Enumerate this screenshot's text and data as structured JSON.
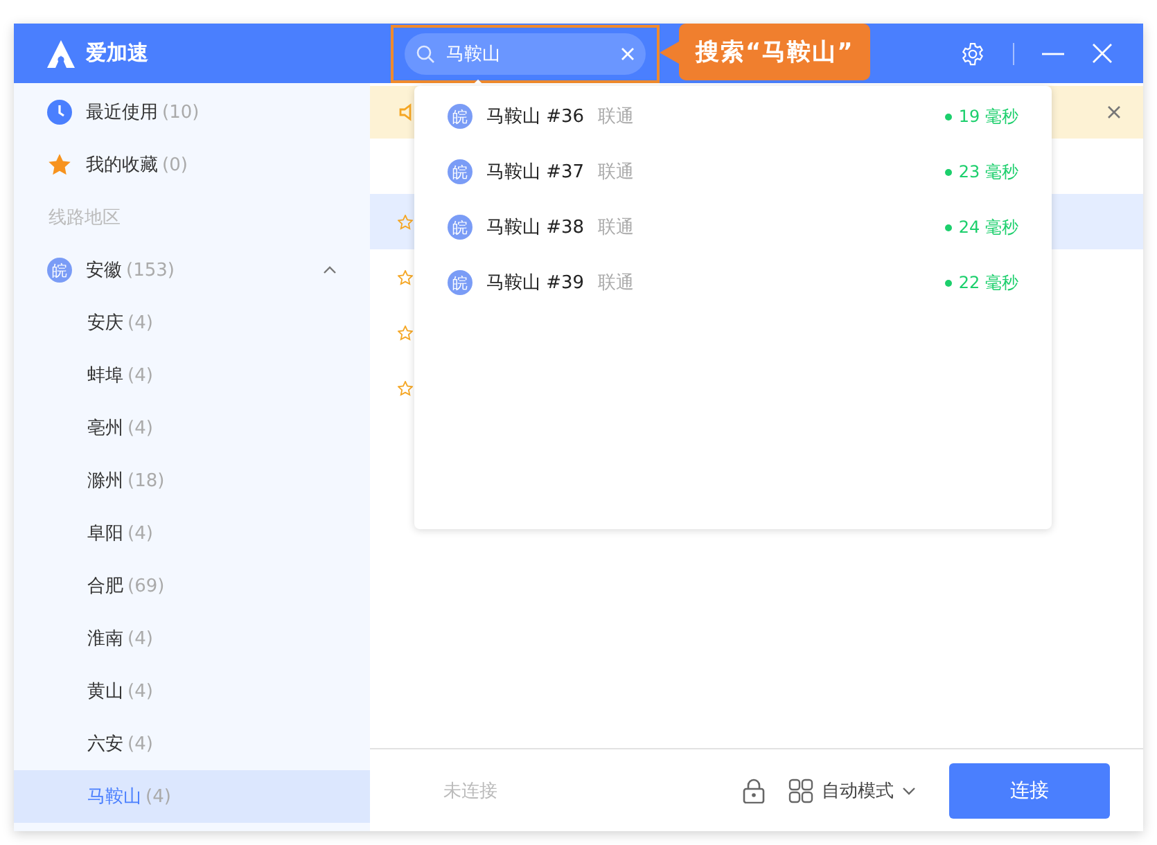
{
  "app": {
    "name": "爱加速"
  },
  "search": {
    "value": "马鞍山"
  },
  "callout": {
    "text": "搜索“马鞍山”"
  },
  "sidebar": {
    "shortcuts": [
      {
        "kind": "recent",
        "label": "最近使用",
        "count": "(10)"
      },
      {
        "kind": "favorites",
        "label": "我的收藏",
        "count": "(0)"
      }
    ],
    "section_title": "线路地区",
    "regions": [
      {
        "badge": "皖",
        "label": "安徽",
        "count": "(153)",
        "expanded": true,
        "children": [
          {
            "label": "安庆",
            "count": "(4)",
            "selected": false
          },
          {
            "label": "蚌埠",
            "count": "(4)",
            "selected": false
          },
          {
            "label": "亳州",
            "count": "(4)",
            "selected": false
          },
          {
            "label": "滁州",
            "count": "(18)",
            "selected": false
          },
          {
            "label": "阜阳",
            "count": "(4)",
            "selected": false
          },
          {
            "label": "合肥",
            "count": "(69)",
            "selected": false
          },
          {
            "label": "淮南",
            "count": "(4)",
            "selected": false
          },
          {
            "label": "黄山",
            "count": "(4)",
            "selected": false
          },
          {
            "label": "六安",
            "count": "(4)",
            "selected": false
          },
          {
            "label": "马鞍山",
            "count": "(4)",
            "selected": true
          }
        ]
      }
    ]
  },
  "server_rows": [
    {
      "selected": false
    },
    {
      "selected": true
    },
    {
      "selected": false
    },
    {
      "selected": false
    },
    {
      "selected": false
    }
  ],
  "results": [
    {
      "badge": "皖",
      "name": "马鞍山 #36",
      "isp": "联通",
      "latency": "19 毫秒"
    },
    {
      "badge": "皖",
      "name": "马鞍山 #37",
      "isp": "联通",
      "latency": "23 毫秒"
    },
    {
      "badge": "皖",
      "name": "马鞍山 #38",
      "isp": "联通",
      "latency": "24 毫秒"
    },
    {
      "badge": "皖",
      "name": "马鞍山 #39",
      "isp": "联通",
      "latency": "22 毫秒"
    }
  ],
  "footer": {
    "status": "未连接",
    "mode": "自动模式",
    "connect_button": "连接"
  }
}
